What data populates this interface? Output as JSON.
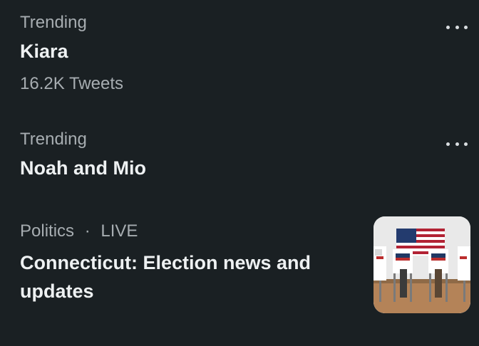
{
  "trends": [
    {
      "meta": "Trending",
      "title": "Kiara",
      "count": "16.2K Tweets"
    },
    {
      "meta": "Trending",
      "title": "Noah and Mio"
    }
  ],
  "live_story": {
    "category": "Politics",
    "separator": "·",
    "badge": "LIVE",
    "title": "Connecticut: Election news and updates"
  },
  "colors": {
    "background": "#1a2023",
    "primary_text": "#eef1f2",
    "secondary_text": "#a7adb1"
  },
  "icons": {
    "more_menu": "more-horizontal-icon",
    "thumbnail": "voting-booths-photo"
  }
}
